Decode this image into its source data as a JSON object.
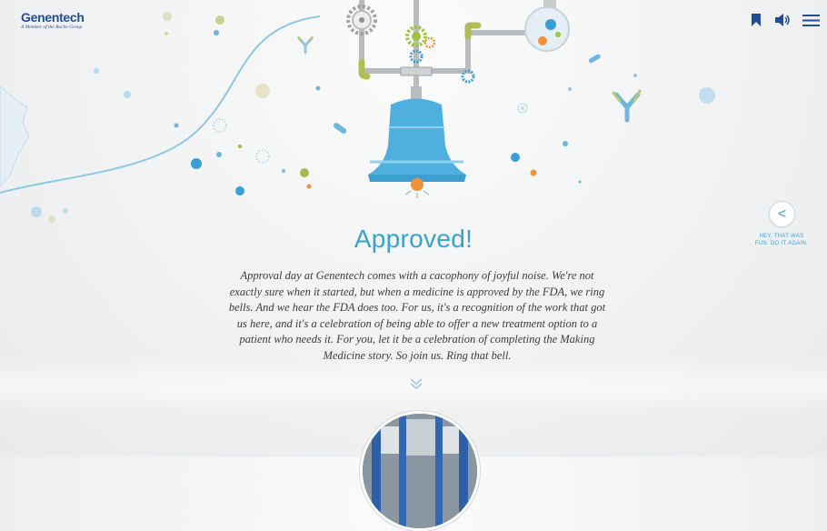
{
  "brand": {
    "name": "Genentech",
    "tagline": "A Member of the Roche Group"
  },
  "toolbar": {
    "icons": [
      "bookmark-icon",
      "speaker-icon",
      "menu-icon"
    ],
    "accent_color": "#1f4d9a"
  },
  "main": {
    "title": "Approved!",
    "body": "Approval day at Genentech comes with a cacophony of joyful noise. We're not exactly sure when it started, but when a medicine is approved by the FDA, we ring bells. And we hear the FDA does too. For us, it's a recognition of the work that got us here, and it's a celebration of being able to offer a new treatment option to a patient who needs it. For you, let it be a celebration of completing the Making Medicine story. So join us. Ring that bell.",
    "title_color": "#39a2cf"
  },
  "replay": {
    "button_glyph": "<",
    "caption_line1": "HEY, THAT WAS",
    "caption_line2": "FUN. DO IT AGAIN."
  },
  "colors": {
    "bell": "#4fb0df",
    "pipe": "#b8bcbf",
    "gear_green": "#9cc53b",
    "orange": "#f0923a"
  }
}
